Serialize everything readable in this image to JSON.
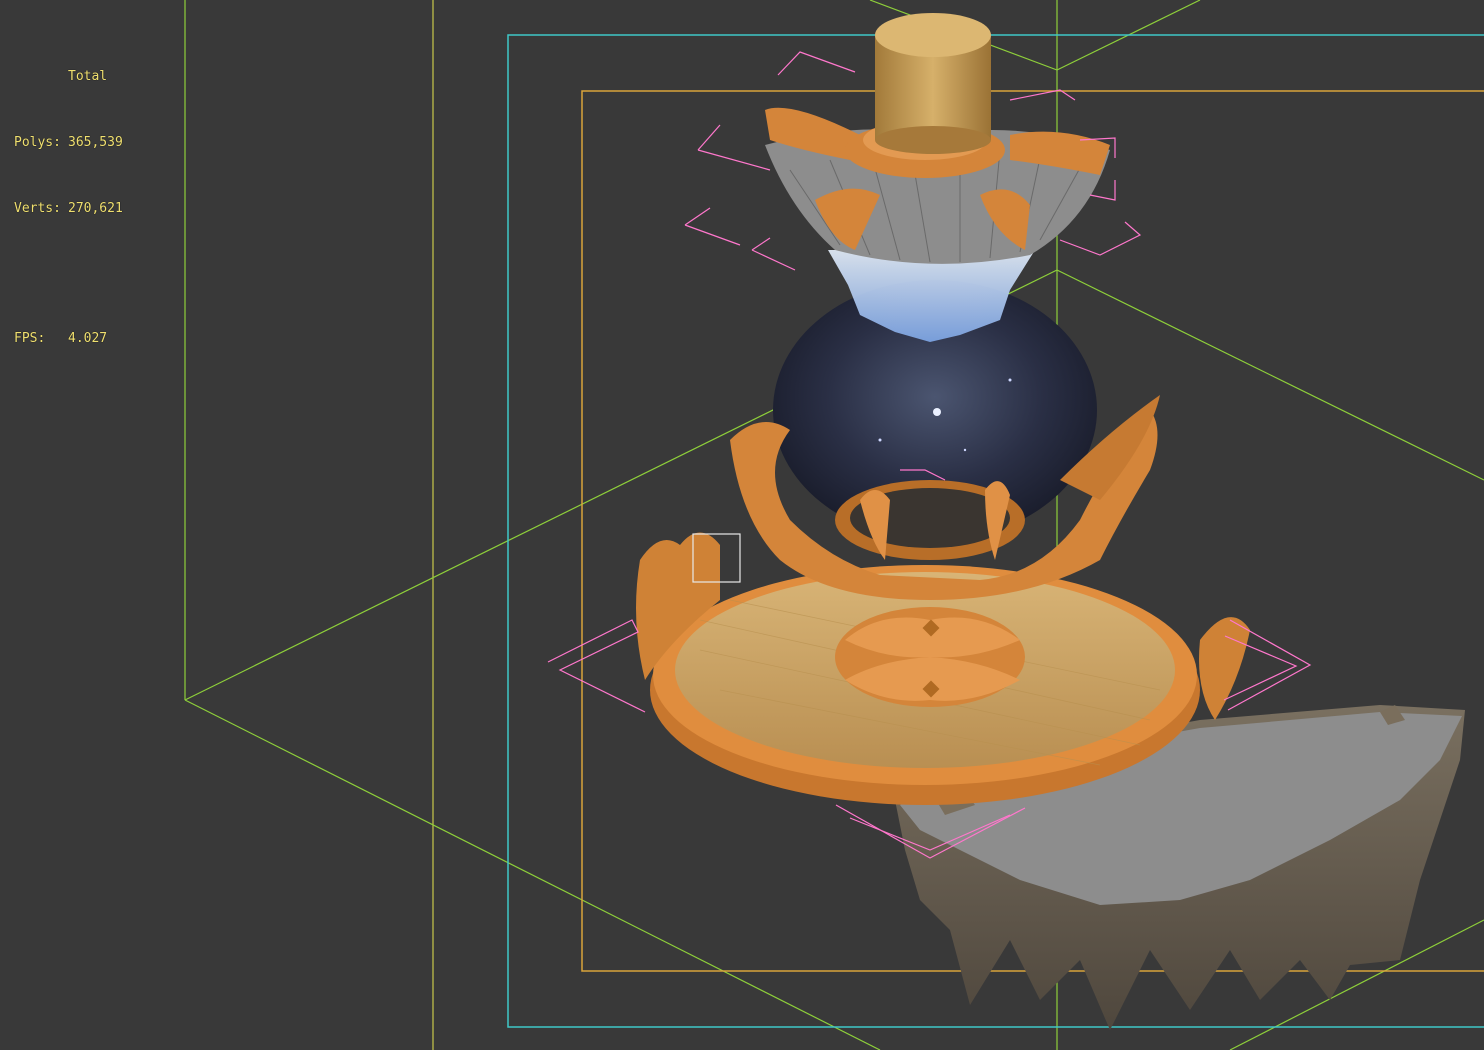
{
  "viewport": {
    "statistics": {
      "total_label": "Total",
      "polys_label": "Polys:",
      "polys_value": "365,539",
      "verts_label": "Verts:",
      "verts_value": "270,621",
      "fps_label": "FPS:",
      "fps_value": "4.027"
    },
    "colors": {
      "background": "#393939",
      "stats_text": "#f0e070",
      "grid_green": "#8ecf3a",
      "safe_frame_cyan": "#3fc8c8",
      "safe_frame_orange": "#d9a43a",
      "selection_pink": "#ff77cc",
      "model_orange": "#d88a3a",
      "floor_tan": "#c8a060",
      "rock_gray": "#8a8a8a"
    }
  }
}
